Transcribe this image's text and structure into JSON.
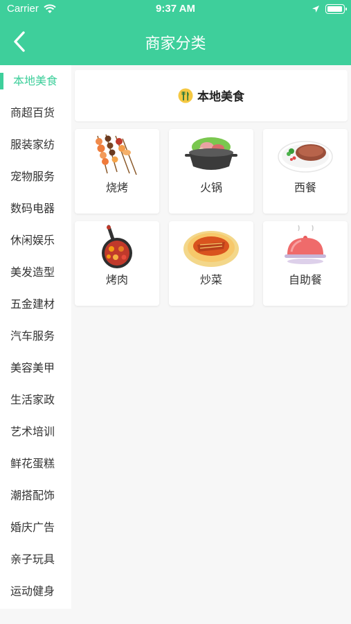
{
  "status": {
    "carrier": "Carrier",
    "time": "9:37 AM"
  },
  "header": {
    "title": "商家分类"
  },
  "sidebar": {
    "items": [
      {
        "label": "本地美食"
      },
      {
        "label": "商超百货"
      },
      {
        "label": "服装家纺"
      },
      {
        "label": "宠物服务"
      },
      {
        "label": "数码电器"
      },
      {
        "label": "休闲娱乐"
      },
      {
        "label": "美发造型"
      },
      {
        "label": "五金建材"
      },
      {
        "label": "汽车服务"
      },
      {
        "label": "美容美甲"
      },
      {
        "label": "生活家政"
      },
      {
        "label": "艺术培训"
      },
      {
        "label": "鲜花蛋糕"
      },
      {
        "label": "潮搭配饰"
      },
      {
        "label": "婚庆广告"
      },
      {
        "label": "亲子玩具"
      },
      {
        "label": "运动健身"
      }
    ]
  },
  "category": {
    "title": "本地美食",
    "icon": "utensils-icon",
    "items": [
      {
        "label": "烧烤",
        "icon": "skewers-icon"
      },
      {
        "label": "火锅",
        "icon": "hotpot-icon"
      },
      {
        "label": "西餐",
        "icon": "steak-icon"
      },
      {
        "label": "烤肉",
        "icon": "grill-pan-icon"
      },
      {
        "label": "炒菜",
        "icon": "stir-fry-icon"
      },
      {
        "label": "自助餐",
        "icon": "cloche-icon"
      }
    ]
  },
  "colors": {
    "accent": "#3ecf9b",
    "background": "#f7f7f7"
  }
}
